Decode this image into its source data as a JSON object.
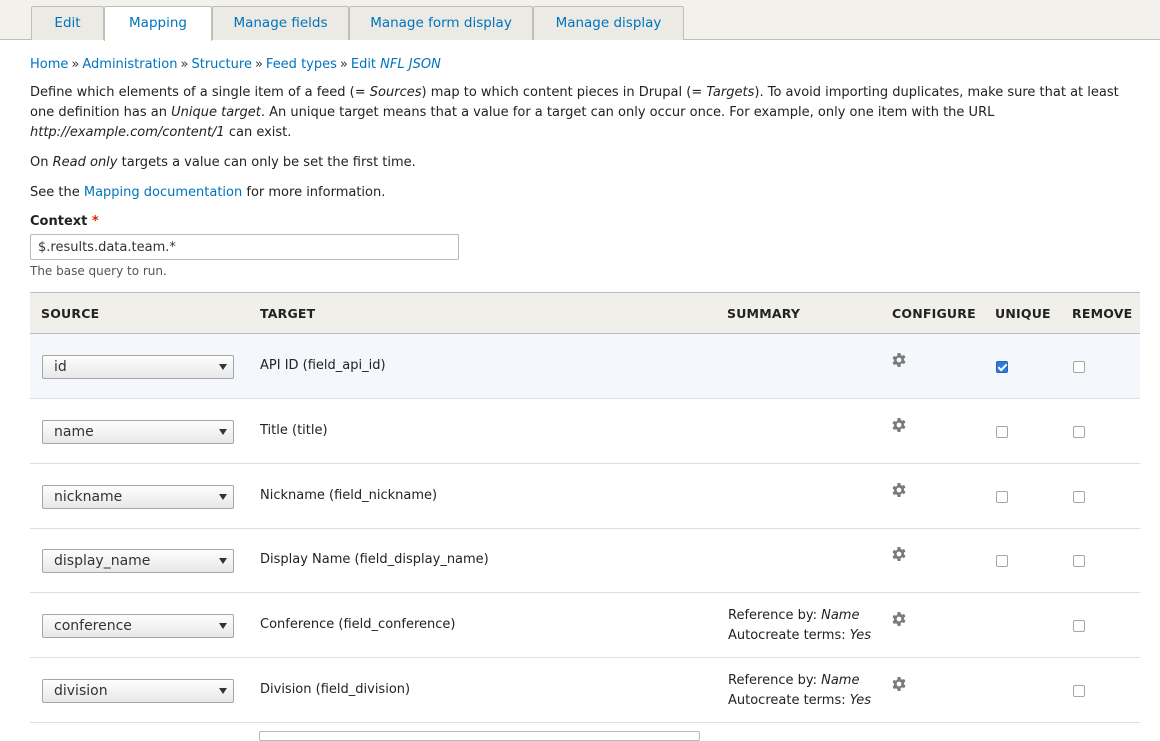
{
  "tabs": [
    {
      "label": "Edit"
    },
    {
      "label": "Mapping"
    },
    {
      "label": "Manage fields"
    },
    {
      "label": "Manage form display"
    },
    {
      "label": "Manage display"
    }
  ],
  "breadcrumb": {
    "home": "Home",
    "administration": "Administration",
    "structure": "Structure",
    "feed_types": "Feed types",
    "edit_prefix": "Edit ",
    "edit_name": "NFL JSON",
    "separator": "»"
  },
  "intro": {
    "p1_a": "Define which elements of a single item of a feed (= ",
    "p1_sources": "Sources",
    "p1_b": ") map to which content pieces in Drupal (= ",
    "p1_targets": "Targets",
    "p1_c": "). To avoid importing duplicates, make sure that at least one definition has an ",
    "p1_unique": "Unique target",
    "p1_d": ". An unique target means that a value for a target can only occur once. For example, only one item with the URL ",
    "p1_url": "http://example.com/content/1",
    "p1_e": " can exist.",
    "p2_a": "On ",
    "p2_readonly": "Read only",
    "p2_b": " targets a value can only be set the first time.",
    "p3_a": "See the ",
    "p3_link": "Mapping documentation",
    "p3_b": " for more information."
  },
  "context": {
    "label": "Context",
    "required_mark": "*",
    "value": "$.results.data.team.*",
    "description": "The base query to run."
  },
  "table": {
    "headers": {
      "source": "Source",
      "target": "Target",
      "summary": "Summary",
      "configure": "Configure",
      "unique": "Unique",
      "remove": "Remove"
    },
    "rows": [
      {
        "source": "id",
        "target": "API ID (field_api_id)",
        "summary_line1_label": "",
        "summary_line1_value": "",
        "summary_line2_label": "",
        "summary_line2_value": "",
        "unique_checked": true,
        "has_unique": true
      },
      {
        "source": "name",
        "target": "Title (title)",
        "summary_line1_label": "",
        "summary_line1_value": "",
        "summary_line2_label": "",
        "summary_line2_value": "",
        "unique_checked": false,
        "has_unique": true
      },
      {
        "source": "nickname",
        "target": "Nickname (field_nickname)",
        "summary_line1_label": "",
        "summary_line1_value": "",
        "summary_line2_label": "",
        "summary_line2_value": "",
        "unique_checked": false,
        "has_unique": true
      },
      {
        "source": "display_name",
        "target": "Display Name (field_display_name)",
        "summary_line1_label": "",
        "summary_line1_value": "",
        "summary_line2_label": "",
        "summary_line2_value": "",
        "unique_checked": false,
        "has_unique": true
      },
      {
        "source": "conference",
        "target": "Conference (field_conference)",
        "summary_line1_label": "Reference by: ",
        "summary_line1_value": "Name",
        "summary_line2_label": "Autocreate terms: ",
        "summary_line2_value": "Yes",
        "unique_checked": false,
        "has_unique": false
      },
      {
        "source": "division",
        "target": "Division (field_division)",
        "summary_line1_label": "Reference by: ",
        "summary_line1_value": "Name",
        "summary_line2_label": "Autocreate terms: ",
        "summary_line2_value": "Yes",
        "unique_checked": false,
        "has_unique": false
      }
    ]
  },
  "colors": {
    "link": "#0074bd",
    "required": "#e32700",
    "highlight_row": "#f4f8fc",
    "checkbox_checked": "#2c7cdc"
  },
  "icons": {
    "configure": "gear-icon",
    "select_arrow": "chevron-down-icon"
  }
}
